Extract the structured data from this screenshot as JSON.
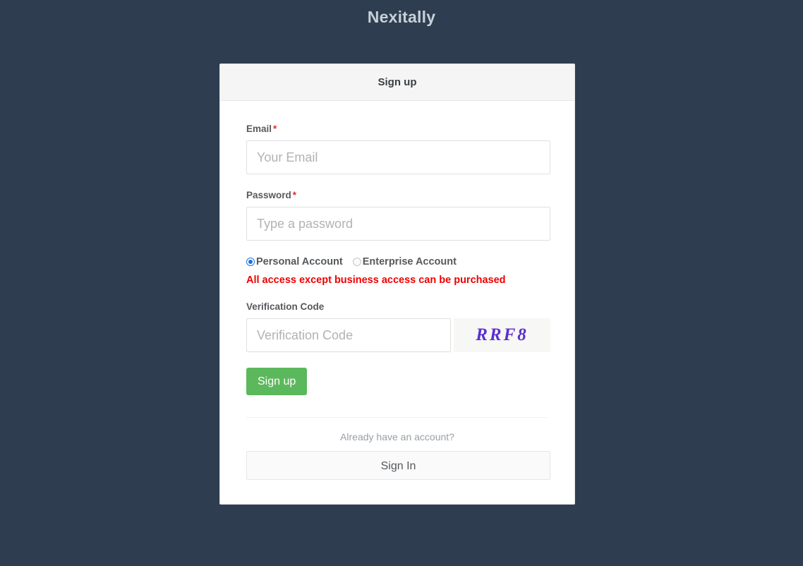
{
  "brand": {
    "title": "Nexitally"
  },
  "card": {
    "header_title": "Sign up",
    "email": {
      "label": "Email",
      "required_marker": "*",
      "placeholder": "Your Email",
      "value": ""
    },
    "password": {
      "label": "Password",
      "required_marker": "*",
      "placeholder": "Type a password",
      "value": ""
    },
    "account_type": {
      "options": [
        {
          "label": "Personal Account",
          "selected": true
        },
        {
          "label": "Enterprise Account",
          "selected": false
        }
      ],
      "warning": "All access except business access can be purchased"
    },
    "verification": {
      "label": "Verification Code",
      "placeholder": "Verification Code",
      "value": "",
      "captcha_text": "RRF8"
    },
    "signup_button_label": "Sign up",
    "footer": {
      "already_text": "Already have an account?",
      "signin_button_label": "Sign In"
    }
  },
  "colors": {
    "page_background": "#2e3e50",
    "brand_text": "#c8d0d8",
    "card_header_background": "#f5f5f5",
    "required_asterisk": "#e8282b",
    "warning_text": "#f00000",
    "signup_button": "#5cb85c",
    "captcha_text": "#5b2fd0",
    "radio_selected": "#1273e6"
  }
}
